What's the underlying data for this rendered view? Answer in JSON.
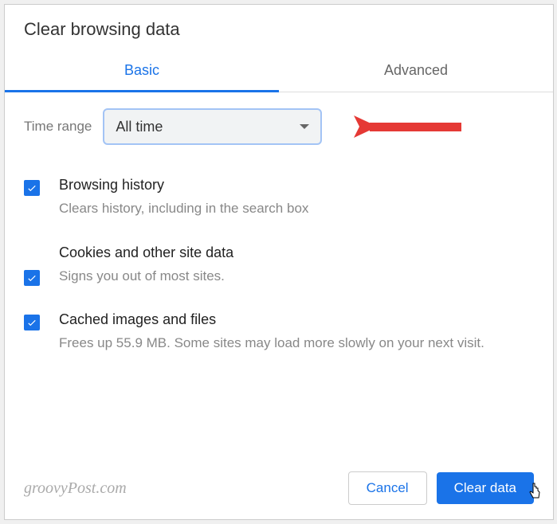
{
  "title": "Clear browsing data",
  "tabs": {
    "basic": "Basic",
    "advanced": "Advanced"
  },
  "timerange": {
    "label": "Time range",
    "value": "All time"
  },
  "options": [
    {
      "title": "Browsing history",
      "desc": "Clears history, including in the search box"
    },
    {
      "title": "Cookies and other site data",
      "desc": "Signs you out of most sites."
    },
    {
      "title": "Cached images and files",
      "desc": "Frees up 55.9 MB. Some sites may load more slowly on your next visit."
    }
  ],
  "watermark": "groovyPost.com",
  "buttons": {
    "cancel": "Cancel",
    "clear": "Clear data"
  }
}
